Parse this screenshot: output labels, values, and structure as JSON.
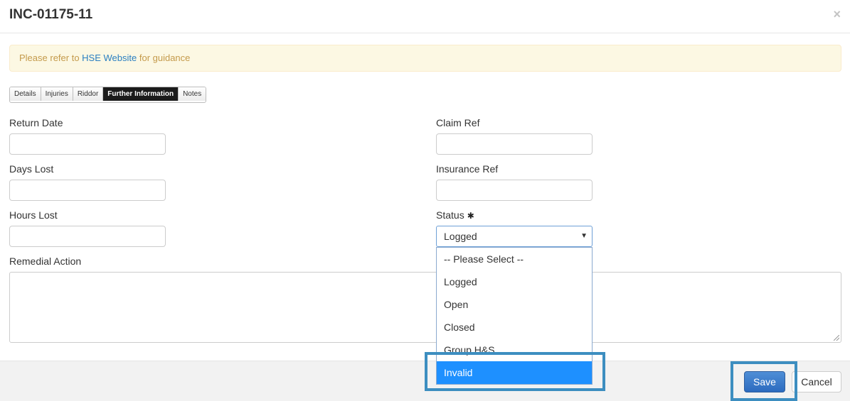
{
  "modal": {
    "title": "INC-01175-11",
    "close_symbol": "×"
  },
  "alert": {
    "prefix": "Please refer to ",
    "link": "HSE Website",
    "suffix": " for guidance"
  },
  "tabs": [
    {
      "label": "Details",
      "active": false
    },
    {
      "label": "Injuries",
      "active": false
    },
    {
      "label": "Riddor",
      "active": false
    },
    {
      "label": "Further Information",
      "active": true
    },
    {
      "label": "Notes",
      "active": false
    }
  ],
  "form": {
    "return_date": {
      "label": "Return Date",
      "value": ""
    },
    "days_lost": {
      "label": "Days Lost",
      "value": ""
    },
    "hours_lost": {
      "label": "Hours Lost",
      "value": ""
    },
    "claim_ref": {
      "label": "Claim Ref",
      "value": ""
    },
    "insurance_ref": {
      "label": "Insurance Ref",
      "value": ""
    },
    "status": {
      "label": "Status",
      "required_mark": "✱",
      "selected": "Logged",
      "arrow": "▼",
      "options": [
        "-- Please Select --",
        "Logged",
        "Open",
        "Closed",
        "Group H&S",
        "Invalid"
      ],
      "highlighted_option": "Invalid"
    },
    "remedial_action": {
      "label": "Remedial Action",
      "value": ""
    }
  },
  "footer": {
    "save_label": "Save",
    "cancel_label": "Cancel"
  },
  "colors": {
    "highlight_box": "#3d8ec0",
    "active_tab": "#1b1b1b",
    "selected_option": "#1e90ff",
    "save_button": "#2c6bbf"
  }
}
